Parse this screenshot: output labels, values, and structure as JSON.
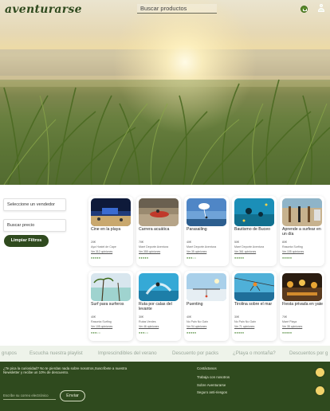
{
  "header": {
    "logo": "aventurarse",
    "search_placeholder": "Buscar productos"
  },
  "filters": {
    "vendor_placeholder": "Seleccione un vendedor",
    "price_placeholder": "Buscar precio",
    "clear_label": "Limpiar Filtros"
  },
  "products": [
    {
      "title": "Cine en la playa",
      "price": "20€",
      "vendor": "Aya Hostel de Cape",
      "opinions": "Ver 312 opiniones",
      "stars": "●●●●●"
    },
    {
      "title": "Carrera acuática",
      "price": "70€",
      "vendor": "Maré Deporte Aventura",
      "opinions": "Ver 355 opiniones",
      "stars": "●●●●●"
    },
    {
      "title": "Parasailing",
      "price": "40€",
      "vendor": "Maré Deporte Aventura",
      "opinions": "Ver 35 opiniones",
      "stars": "●●●○○"
    },
    {
      "title": "Bautismo de Buceo",
      "price": "50€",
      "vendor": "Maré Deporte Aventura",
      "opinions": "Ver 361 opiniones",
      "stars": "●●●●●"
    },
    {
      "title": "Aprende a surfear en un día",
      "price": "80€",
      "vendor": "Rasonta Surfing",
      "opinions": "Ver 105 opiniones",
      "stars": "●●●●●"
    },
    {
      "title": "Surf para surferos",
      "price": "40€",
      "vendor": "Rasonta Surfing",
      "opinions": "Ver 105 opiniones",
      "stars": "●●●○○"
    },
    {
      "title": "Ruta por calas del levante",
      "price": "30€",
      "vendor": "Rutas Verdes",
      "opinions": "Ver 46 opiniones",
      "stars": "●●●○○"
    },
    {
      "title": "Puenting",
      "price": "40€",
      "vendor": "No Pain No Gain",
      "opinions": "Ver 94 opiniones",
      "stars": "●●●●●"
    },
    {
      "title": "Tirolina sobre el mar",
      "price": "30€",
      "vendor": "No Pain No Gain",
      "opinions": "Ver 71 opiniones",
      "stars": "●●●●●"
    },
    {
      "title": "Fiesta privada en yate",
      "price": "70€",
      "vendor": "Maré Playa",
      "opinions": "Ver 35 opiniones",
      "stars": "●●●●●"
    }
  ],
  "marquee": [
    "grupos",
    "Escucha nuestra playlist",
    "Imprescindibles del verano",
    "Descuento por packs",
    "¿Playa o montaña?",
    "Descuentos por g"
  ],
  "footer": {
    "promo": "¿Te pica la curiosidad? No te pierdas nada sobre nosotros,Suscríbete a nuestra Newsletter y recibe un 10% de descuento.",
    "email_placeholder": "Escribe su correo electrónico",
    "send_label": "Enviar",
    "links": [
      "Contáctanos",
      "Trabaja con nosotros",
      "Sobre Aventurarse",
      "Seguro anti-riesgos"
    ]
  },
  "colors": {
    "brand_green": "#2f4a1e",
    "star_green": "#3a7a22",
    "social_yellow": "#f2d36b"
  }
}
